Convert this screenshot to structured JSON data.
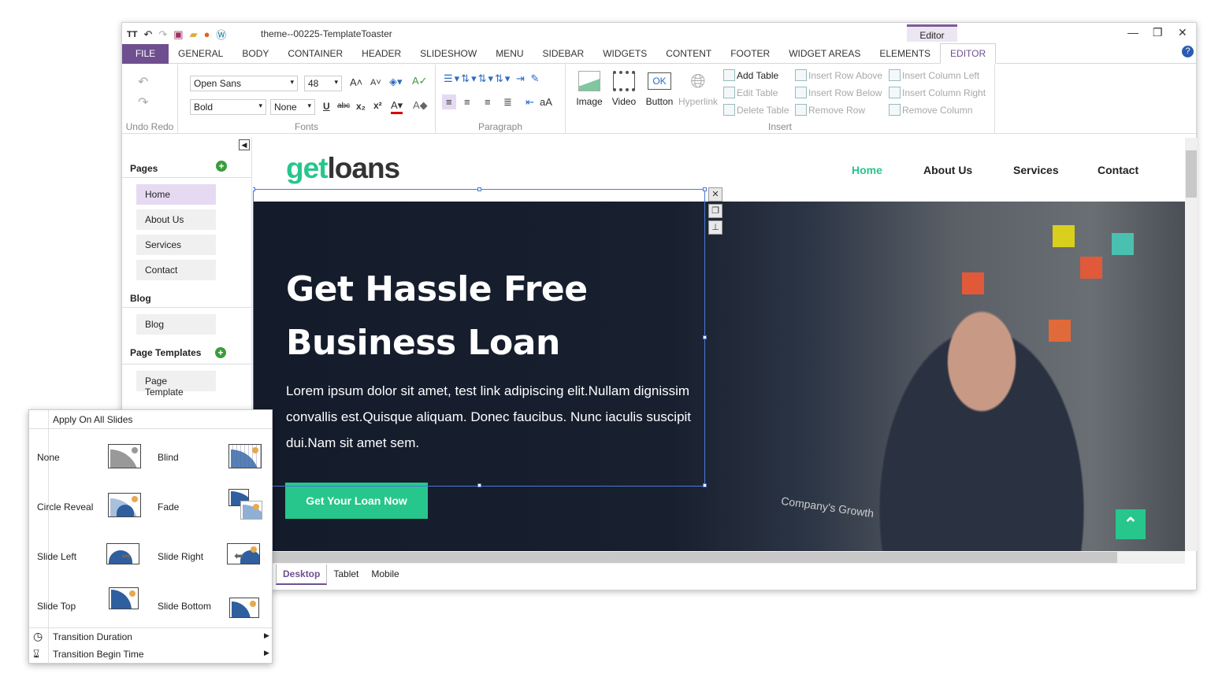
{
  "window": {
    "title": "theme--00225-TemplateToaster",
    "context_tab": "Editor",
    "controls": [
      "—",
      "❐",
      "✕"
    ]
  },
  "tabs": [
    "FILE",
    "GENERAL",
    "BODY",
    "CONTAINER",
    "HEADER",
    "SLIDESHOW",
    "MENU",
    "SIDEBAR",
    "WIDGETS",
    "CONTENT",
    "FOOTER",
    "WIDGET AREAS",
    "ELEMENTS",
    "EDITOR"
  ],
  "active_tab": "EDITOR",
  "ribbon": {
    "undo_redo_label": "Undo Redo",
    "fonts": {
      "font": "Open Sans",
      "size": "48",
      "weight": "Bold",
      "decoration": "None",
      "label": "Fonts"
    },
    "paragraph": {
      "label": "Paragraph",
      "case": "aA"
    },
    "insert": {
      "label": "Insert",
      "image": "Image",
      "video": "Video",
      "button": "Button",
      "button_icon": "OK",
      "hyperlink": "Hyperlink",
      "add_table": "Add Table",
      "edit_table": "Edit Table",
      "delete_table": "Delete Table",
      "row_above": "Insert Row Above",
      "row_below": "Insert Row Below",
      "remove_row": "Remove Row",
      "col_left": "Insert Column Left",
      "col_right": "Insert Column Right",
      "remove_col": "Remove Column"
    }
  },
  "sidebar": {
    "pages_header": "Pages",
    "pages": [
      "Home",
      "About Us",
      "Services",
      "Contact"
    ],
    "selected": "Home",
    "blog_header": "Blog",
    "blog": [
      "Blog"
    ],
    "templates_header": "Page Templates",
    "templates": [
      "Page Template"
    ]
  },
  "site": {
    "logo_a": "get",
    "logo_b": "loans",
    "nav": [
      "Home",
      "About Us",
      "Services",
      "Contact"
    ],
    "active_nav": "Home",
    "heading_1": "Get Hassle Free",
    "heading_2": "Business Loan",
    "paragraph": "Lorem ipsum dolor sit amet, test link adipiscing elit.Nullam dignissim convallis est.Quisque aliquam. Donec faucibus. Nunc iaculis suscipit dui.Nam sit amet sem.",
    "cta": "Get Your Loan Now",
    "laptop_text": "Company's Growth"
  },
  "colors": {
    "accent": "#27c68c",
    "brand": "#6f4f8f",
    "selection": "#4a78d6"
  },
  "view_tabs": [
    "Desktop",
    "Tablet",
    "Mobile"
  ],
  "active_view": "Desktop",
  "popup": {
    "apply_all": "Apply On All Slides",
    "transitions": [
      "None",
      "Blind",
      "Circle Reveal",
      "Fade",
      "Slide Left",
      "Slide Right",
      "Slide Top",
      "Slide Bottom"
    ],
    "duration": "Transition Duration",
    "begin": "Transition Begin Time"
  }
}
